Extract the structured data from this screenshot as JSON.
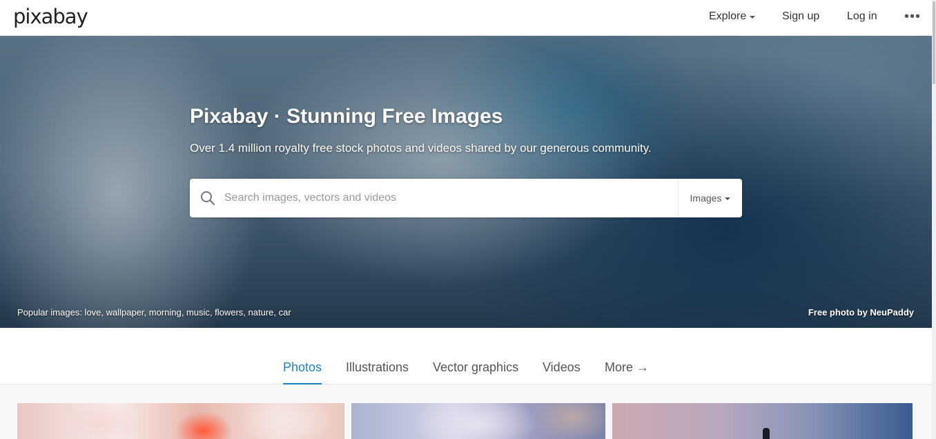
{
  "header": {
    "logo": "pixabay",
    "nav": {
      "explore": "Explore",
      "signup": "Sign up",
      "login": "Log in",
      "more": "•••"
    }
  },
  "hero": {
    "title": "Pixabay · Stunning Free Images",
    "subtitle": "Over 1.4 million royalty free stock photos and videos shared by our generous community.",
    "search": {
      "placeholder": "Search images, vectors and videos",
      "value": "",
      "type_selected": "Images",
      "icon": "search-icon"
    },
    "popular": "Popular images: love, wallpaper, morning, music, flowers, nature, car",
    "credit": "Free photo by NeuPaddy"
  },
  "tabs": [
    {
      "label": "Photos",
      "active": true
    },
    {
      "label": "Illustrations",
      "active": false
    },
    {
      "label": "Vector graphics",
      "active": false
    },
    {
      "label": "Videos",
      "active": false
    },
    {
      "label": "More →",
      "active": false
    }
  ],
  "colors": {
    "accent": "#1a85c6",
    "header_bg": "#ffffff",
    "page_bg": "#f6f7f8"
  }
}
